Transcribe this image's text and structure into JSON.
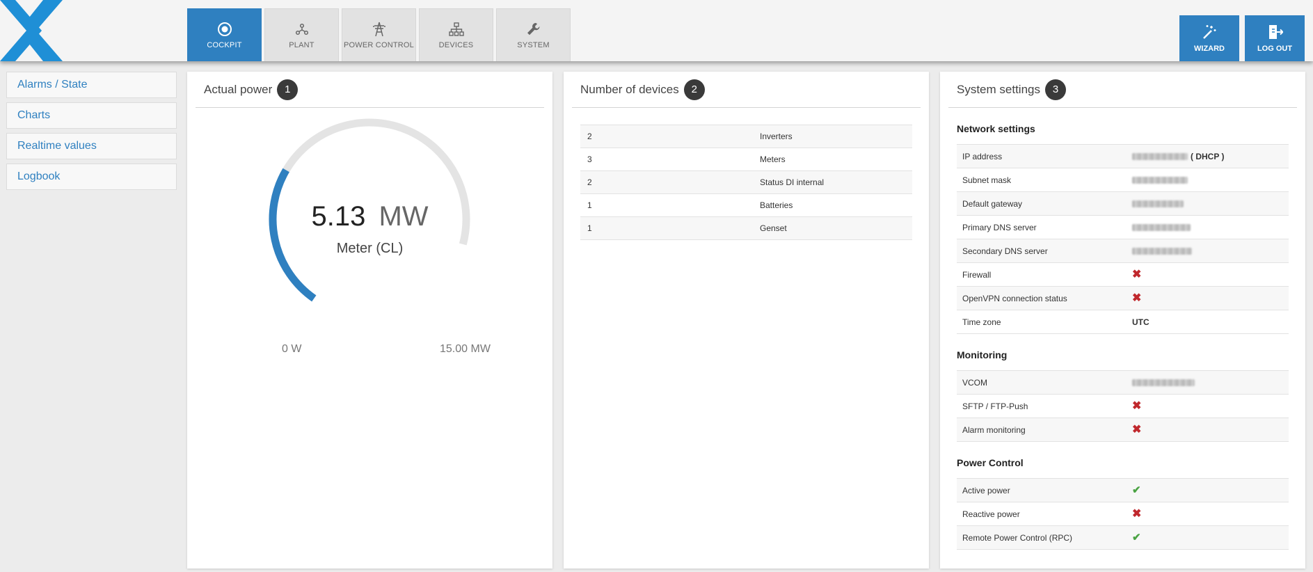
{
  "nav": {
    "tabs": [
      {
        "label": "COCKPIT",
        "icon": "target-icon",
        "active": true
      },
      {
        "label": "PLANT",
        "icon": "network-icon",
        "active": false
      },
      {
        "label": "POWER CONTROL",
        "icon": "power-tower-icon",
        "active": false
      },
      {
        "label": "DEVICES",
        "icon": "hierarchy-icon",
        "active": false
      },
      {
        "label": "SYSTEM",
        "icon": "wrench-icon",
        "active": false
      }
    ],
    "actions": [
      {
        "label": "WIZARD",
        "icon": "magic-wand-icon"
      },
      {
        "label": "LOG OUT",
        "icon": "logout-icon"
      }
    ]
  },
  "sidebar": {
    "items": [
      {
        "label": "Alarms / State"
      },
      {
        "label": "Charts"
      },
      {
        "label": "Realtime values"
      },
      {
        "label": "Logbook"
      }
    ]
  },
  "power_panel": {
    "title": "Actual power",
    "badge": "1",
    "value": "5.13",
    "unit": "MW",
    "label": "Meter (CL)",
    "min_label": "0 W",
    "max_label": "15.00 MW",
    "fill_fraction": 0.342
  },
  "devices_panel": {
    "title": "Number of devices",
    "badge": "2",
    "rows": [
      {
        "count": "2",
        "name": "Inverters"
      },
      {
        "count": "3",
        "name": "Meters"
      },
      {
        "count": "2",
        "name": "Status DI internal"
      },
      {
        "count": "1",
        "name": "Batteries"
      },
      {
        "count": "1",
        "name": "Genset"
      }
    ]
  },
  "settings_panel": {
    "title": "System settings",
    "badge": "3",
    "network": {
      "title": "Network settings",
      "ip_label": "IP address",
      "ip_suffix": "( DHCP )",
      "subnet_label": "Subnet mask",
      "gateway_label": "Default gateway",
      "dns1_label": "Primary DNS server",
      "dns2_label": "Secondary DNS server",
      "firewall_label": "Firewall",
      "openvpn_label": "OpenVPN connection status",
      "timezone_label": "Time zone",
      "timezone_value": "UTC"
    },
    "monitoring": {
      "title": "Monitoring",
      "vcom_label": "VCOM",
      "sftp_label": "SFTP / FTP-Push",
      "alarm_label": "Alarm monitoring"
    },
    "power_control": {
      "title": "Power Control",
      "active_label": "Active power",
      "reactive_label": "Reactive power",
      "rpc_label": "Remote Power Control (RPC)"
    }
  },
  "colors": {
    "accent": "#2f80c0",
    "status_ok": "#4aa343",
    "status_fail": "#c0282d"
  }
}
